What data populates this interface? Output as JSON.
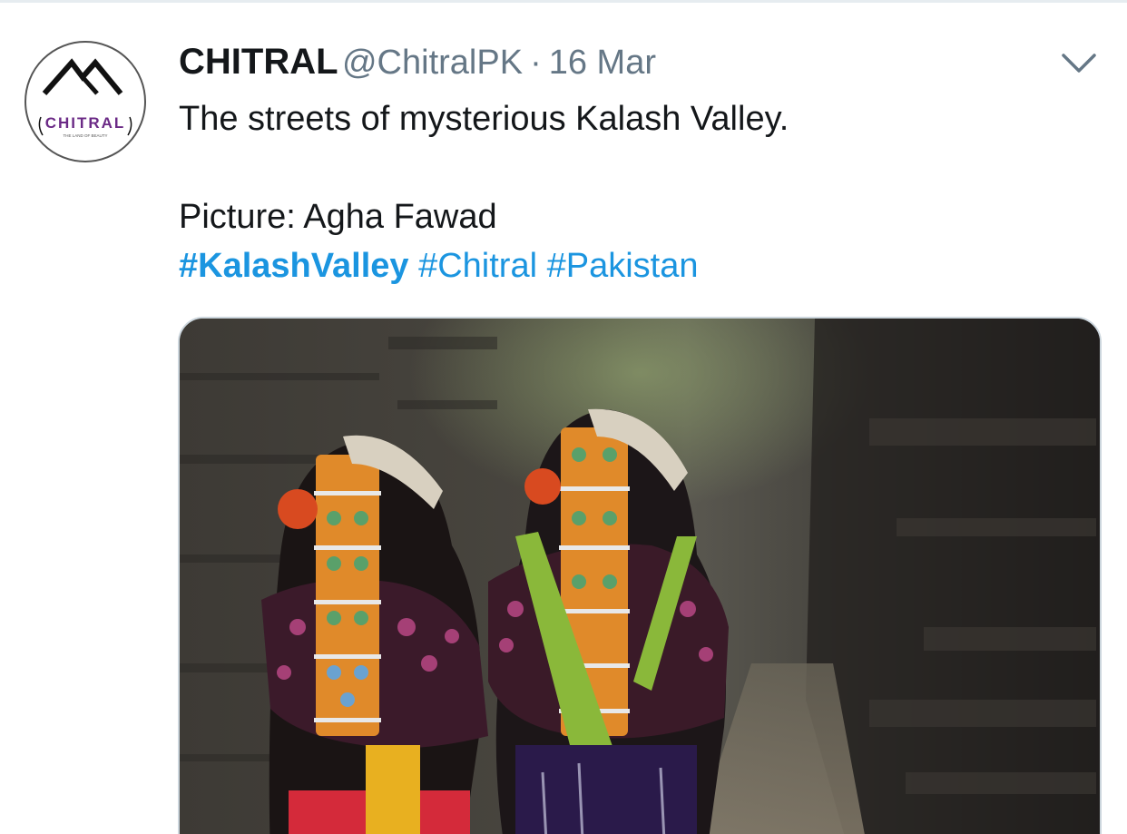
{
  "tweet": {
    "display_name": "CHITRAL",
    "handle": "@ChitralPK",
    "separator": "·",
    "timestamp": "16 Mar",
    "text_line1": "The streets of mysterious Kalash Valley.",
    "text_line2": "Picture: Agha Fawad",
    "hashtags": [
      "#KalashValley",
      "#Chitral",
      "#Pakistan"
    ]
  },
  "avatar": {
    "logo_text": "CHITRAL",
    "logo_tagline": "THE LAND OF BEAUTY",
    "icon": "mountain-logo-icon"
  },
  "menu": {
    "icon": "chevron-down-icon"
  },
  "media": {
    "icon": "photo-image",
    "subject": "two women in colorful headdresses walking down a stone alley"
  },
  "colors": {
    "text": "#14171a",
    "secondary": "#657786",
    "link": "#1b95e0",
    "border": "#ccd6dd",
    "logo_purple": "#6b2a86"
  }
}
